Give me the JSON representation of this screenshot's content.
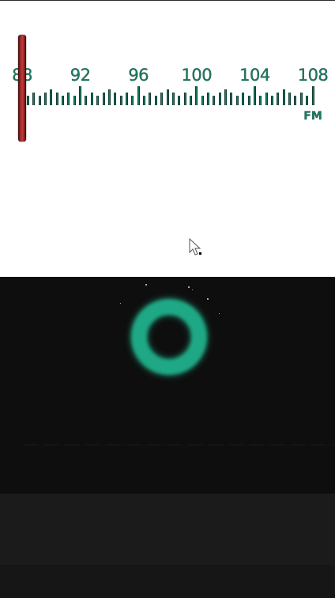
{
  "dial": {
    "frequency_labels": [
      "88",
      "92",
      "96",
      "100",
      "104",
      "108"
    ],
    "band": "FM",
    "min_frequency": 88,
    "max_frequency": 108,
    "tuned_frequency": 88
  },
  "colors": {
    "scale": "#1d7a63",
    "needle": "#c23a3a",
    "knob_ring": "#1fa885",
    "control_background": "#0e0e0e"
  },
  "icons": {
    "cursor": "mouse-pointer-icon"
  }
}
